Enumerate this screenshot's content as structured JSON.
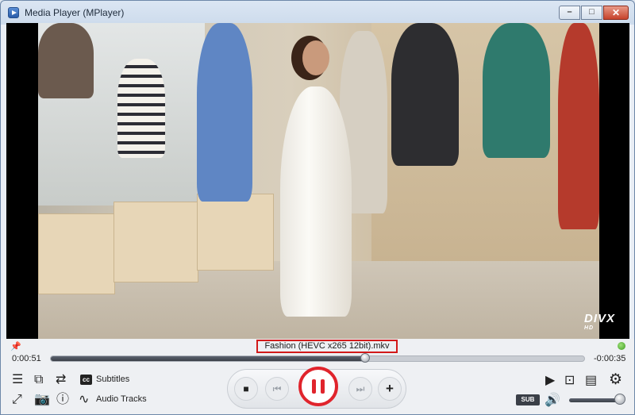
{
  "window": {
    "title": "Media Player (MPlayer)",
    "minimize": "–",
    "maximize": "□",
    "close": "✕"
  },
  "video": {
    "watermark": "DIVX",
    "watermark_sub": "HD"
  },
  "playback": {
    "filename": "Fashion (HEVC x265 12bit).mkv",
    "elapsed": "0:00:51",
    "remaining": "-0:00:35",
    "progress_fraction": 0.59,
    "volume_fraction": 0.9
  },
  "controls": {
    "subtitles_label": "Subtitles",
    "audio_tracks_label": "Audio Tracks",
    "cc_badge": "cc",
    "sub_badge": "SUB"
  },
  "colors": {
    "play_button": "#e0242c",
    "highlight_box": "#d21a1a",
    "status_dot": "#3a9a1e"
  },
  "icons": [
    "playlist-icon",
    "open-icon",
    "shuffle-icon",
    "fullscreen-icon",
    "screenshot-icon",
    "info-icon",
    "audio-wave-icon",
    "stop-icon",
    "previous-icon",
    "pause-icon",
    "next-icon",
    "add-icon",
    "frame-step-icon",
    "video-window-icon",
    "chat-icon",
    "settings-icon",
    "volume-icon"
  ]
}
